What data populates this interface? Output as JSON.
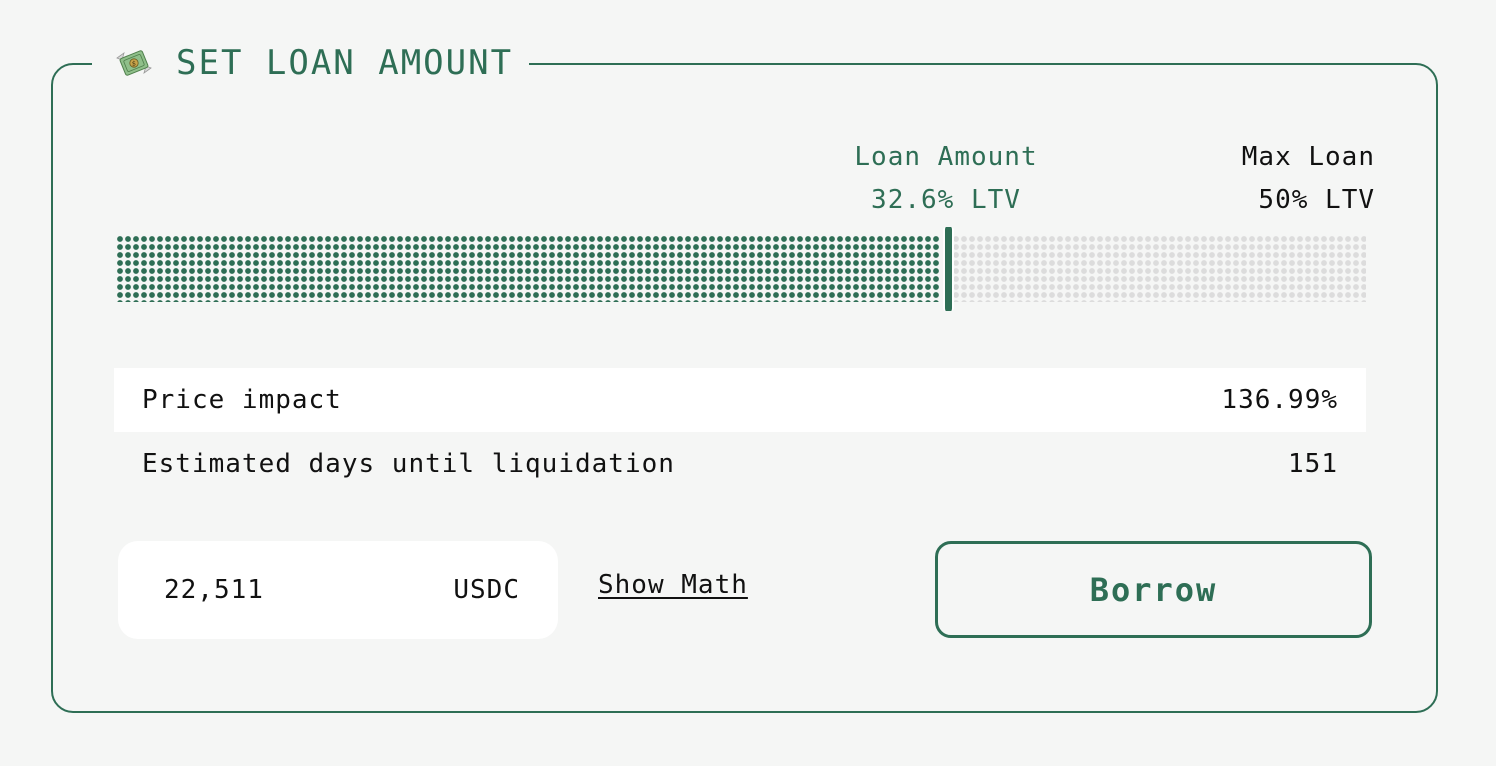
{
  "section": {
    "title": "SET LOAN AMOUNT",
    "icon": "flying-money-icon"
  },
  "markers": {
    "loan_amount": {
      "label": "Loan Amount",
      "value": "32.6% LTV"
    },
    "max_loan": {
      "label": "Max Loan",
      "value": "50% LTV"
    }
  },
  "ltv_bar": {
    "current_ltv_pct": 32.6,
    "max_ltv_pct": 50,
    "fill_fraction": 0.664,
    "fill_color": "#2e6e55",
    "empty_color": "#dcdcdc"
  },
  "stats": [
    {
      "label": "Price impact",
      "value": "136.99%"
    },
    {
      "label": "Estimated days until liquidation",
      "value": "151"
    }
  ],
  "amount_input": {
    "value": "22,511",
    "currency": "USDC"
  },
  "show_math_label": "Show Math",
  "borrow_label": "Borrow",
  "colors": {
    "accent": "#2e6e55",
    "background": "#f5f6f5",
    "text": "#111111"
  }
}
